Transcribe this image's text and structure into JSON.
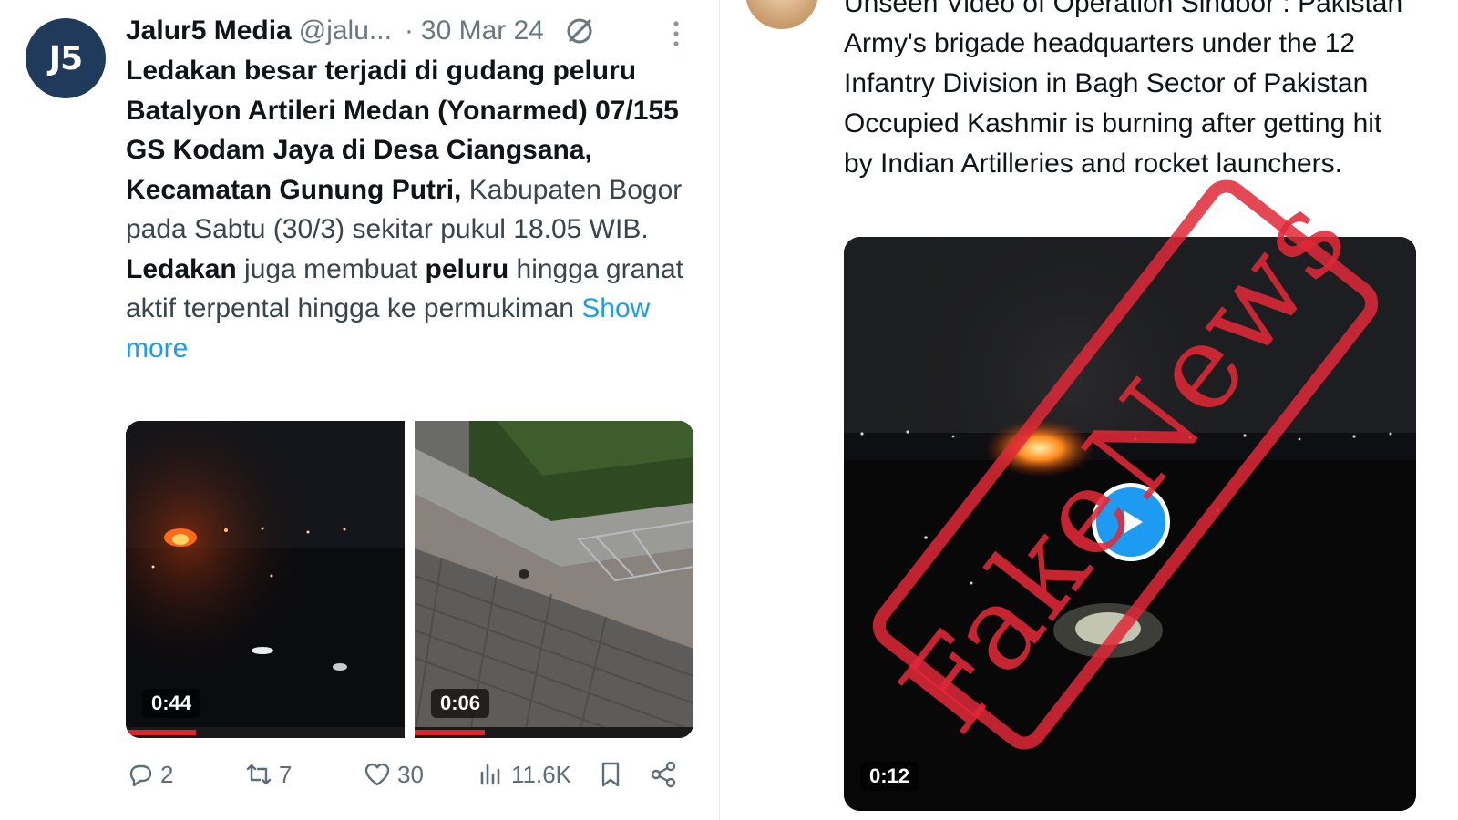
{
  "left_tweet": {
    "avatar_text": "J5",
    "display_name": "Jalur5 Media",
    "handle": "@jalu...",
    "separator": "·",
    "date": "30 Mar 24",
    "text_parts": [
      {
        "text": "Ledakan besar terjadi di gudang peluru Batalyon Artileri Medan (Yonarmed) 07/155 GS Kodam Jaya di Desa Ciangsana, Kecamatan Gunung Putri,",
        "style": "bold"
      },
      {
        "text": " Kabupaten Bogor pada Sabtu (30/3) sekitar pukul 18.05 WIB. ",
        "style": "normal"
      },
      {
        "text": "Ledakan",
        "style": "bold"
      },
      {
        "text": " juga membuat ",
        "style": "normal"
      },
      {
        "text": "peluru",
        "style": "bold"
      },
      {
        "text": " hingga granat aktif terpental hingga ke permukiman ",
        "style": "normal"
      },
      {
        "text": "Show more",
        "style": "link"
      }
    ],
    "media": [
      {
        "duration": "0:44",
        "progress": 0.25
      },
      {
        "duration": "0:06",
        "progress": 0.25
      }
    ],
    "actions": {
      "replies": "2",
      "reposts": "7",
      "likes": "30",
      "views": "11.6K"
    }
  },
  "right_tweet": {
    "text": "Unseen Video of Operation Sindoor : Pakistan Army's brigade headquarters under the 12 Infantry Division in Bagh Sector of Pakistan Occupied Kashmir is burning after getting hit by Indian Artilleries and rocket launchers.",
    "video_duration": "0:12"
  },
  "stamp": {
    "word1": "Fake",
    "word2": "News",
    "color": "#e12837"
  },
  "colors": {
    "link": "#1d9bf0",
    "play_button": "#1d9bf0",
    "muted_text": "#6b7780"
  }
}
